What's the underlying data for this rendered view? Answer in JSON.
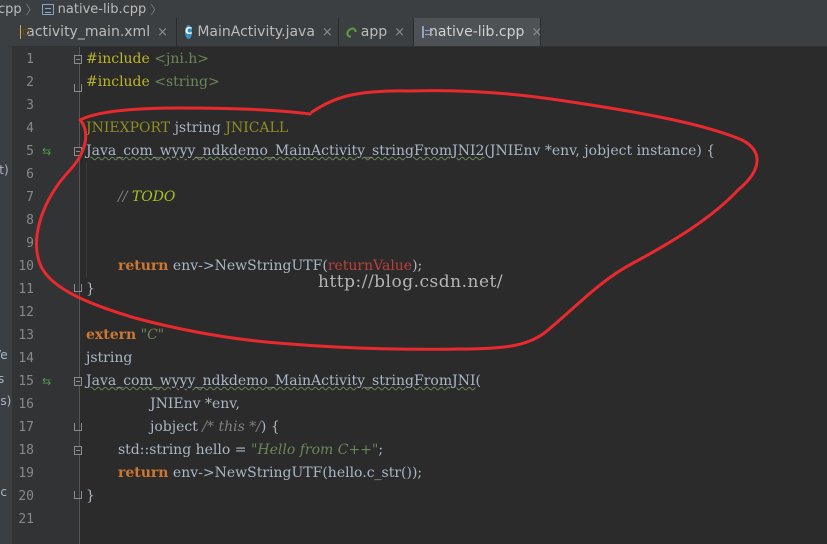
{
  "breadcrumb": {
    "items": [
      "cpp",
      "native-lib.cpp"
    ]
  },
  "left_strip": {
    "fragments": [
      "st)",
      "Ve",
      "s",
      "es)",
      "ac"
    ]
  },
  "tabs": [
    {
      "label": "activity_main.xml",
      "icon": "xml-file-icon",
      "close": "×",
      "active": false
    },
    {
      "label": "MainActivity.java",
      "icon": "java-class-icon",
      "close": "×",
      "active": false
    },
    {
      "label": "app",
      "icon": "gradle-module-icon",
      "close": "×",
      "active": false
    },
    {
      "label": "native-lib.cpp",
      "icon": "cpp-file-icon",
      "close": "×",
      "active": true
    }
  ],
  "gutter": {
    "line_numbers": [
      "1",
      "2",
      "3",
      "4",
      "5",
      "6",
      "7",
      "8",
      "9",
      "10",
      "11",
      "12",
      "13",
      "14",
      "15",
      "16",
      "17",
      "18",
      "19",
      "20",
      "21"
    ],
    "navigate_marker": "⇆"
  },
  "code": {
    "line1": {
      "directive": "#include",
      "header": "<jni.h>"
    },
    "line2": {
      "directive": "#include",
      "header": "<string>"
    },
    "line4": {
      "macro1": "JNIEXPORT",
      "type": "jstring",
      "macro2": "JNICALL"
    },
    "line5": {
      "fn": "Java_com_wyyy_ndkdemo_MainActivity_stringFromJNI2",
      "rest": "(JNIEnv *env, jobject instance) {"
    },
    "line7": {
      "slashes": "// ",
      "todo": "TODO"
    },
    "line10": {
      "kw": "return",
      "call": " env->NewStringUTF(",
      "arg": "returnValue",
      "end": ");"
    },
    "line11": {
      "brace": "}"
    },
    "line13": {
      "kw": "extern",
      "str": "\"C\""
    },
    "line14": {
      "text": "jstring"
    },
    "line15": {
      "fn": "Java_com_wyyy_ndkdemo_MainActivity_stringFromJNI",
      "rest": "("
    },
    "line16": {
      "text": "JNIEnv *env,"
    },
    "line17": {
      "text": "jobject ",
      "cmt": "/* this */",
      "end": ") {"
    },
    "line18": {
      "type": "std::string hello = ",
      "str": "\"Hello from C++\"",
      "end": ";"
    },
    "line19": {
      "kw": "return",
      "call": " env->NewStringUTF(hello.c_str());"
    },
    "line20": {
      "brace": "}"
    }
  },
  "watermark": "http://blog.csdn.net/",
  "colors": {
    "background": "#2b2b2b",
    "keyword": "#cc7832",
    "string": "#6a8759",
    "comment": "#808080",
    "annotation_circle": "#e8292e"
  }
}
